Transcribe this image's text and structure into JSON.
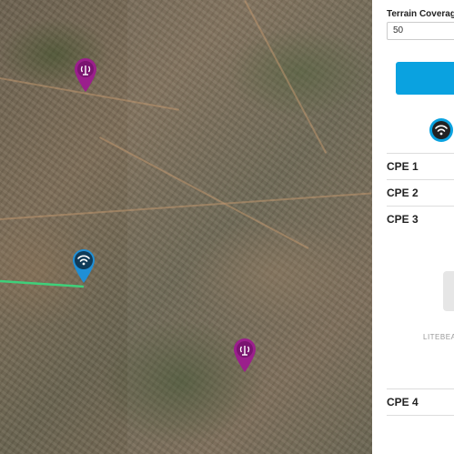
{
  "panel": {
    "terrain_label": "Terrain Coverag",
    "terrain_value": "50",
    "cpe_items": [
      {
        "label": "CPE 1"
      },
      {
        "label": "CPE 2"
      },
      {
        "label": "CPE 3"
      },
      {
        "label": "CPE 4"
      }
    ],
    "device_caption": "LITEBEA"
  },
  "colors": {
    "accent_blue": "#0aa2e0",
    "pin_purple": "#9b1f8c",
    "pin_blue": "#1f8fd6",
    "link_green": "#3fd07a"
  },
  "icons": {
    "tower_pin": "radio-tower-icon",
    "station_pin": "wifi-icon",
    "device": "wifi-icon"
  }
}
